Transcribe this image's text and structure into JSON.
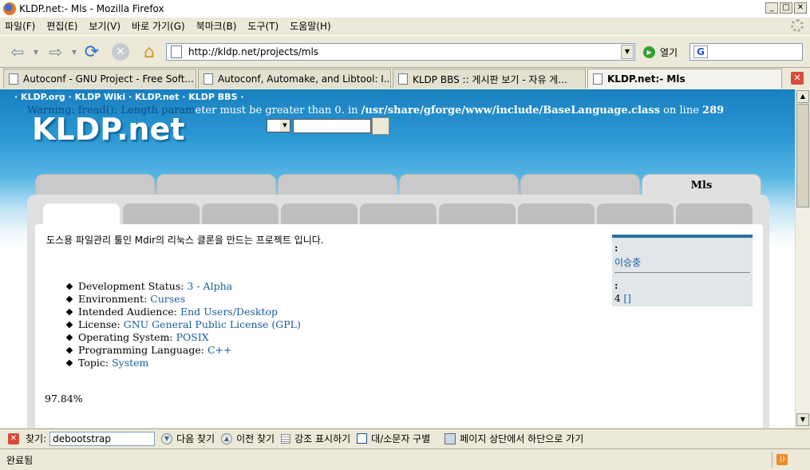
{
  "window": {
    "title": "KLDP.net:- Mls - Mozilla Firefox",
    "controls": {
      "minimize": "_",
      "maximize": "□",
      "close": "✕"
    }
  },
  "menu": [
    "파일(F)",
    "편집(E)",
    "보기(V)",
    "바로 가기(G)",
    "북마크(B)",
    "도구(T)",
    "도움말(H)"
  ],
  "toolbar": {
    "url": "http://kldp.net/projects/mls",
    "go_label": "열기",
    "search_value": "",
    "search_engine": "G"
  },
  "tabs": [
    {
      "label": "Autoconf - GNU Project - Free Soft...",
      "active": false
    },
    {
      "label": "Autoconf, Automake, and Libtool: I...",
      "active": false
    },
    {
      "label": "KLDP BBS :: 게시판 보기 - 자유 게...",
      "active": false
    },
    {
      "label": "KLDP.net:- Mls",
      "active": true
    }
  ],
  "page": {
    "top_links": "· KLDP.org · KLDP Wiki · KLDP.net · KLDP BBS ·",
    "warning_prefix": "Warning: fread(): Length param",
    "warning_text": "eter must be greater than 0. in ",
    "warning_path": "/usr/share/gforge/www/include/BaseLanguage.class",
    "warning_suffix": " on line ",
    "warning_line": "289",
    "logo": "KLDP.net",
    "project_tab": "Mls",
    "description": "도스용 파일관리 툴인 Mdir의 리눅스 클론을 만드는 프로젝트 입니다.",
    "trove": [
      {
        "label": "Development Status: ",
        "value": "3 - Alpha"
      },
      {
        "label": "Environment: ",
        "value": "Curses"
      },
      {
        "label": "Intended Audience: ",
        "value": "End Users/Desktop"
      },
      {
        "label": "License: ",
        "value": "GNU General Public License (GPL)"
      },
      {
        "label": "Operating System: ",
        "value": "POSIX"
      },
      {
        "label": "Programming Language: ",
        "value": "C++"
      },
      {
        "label": "Topic: ",
        "value": "System"
      }
    ],
    "activity_percent": "97.84%",
    "sidebox": {
      "label1": ":",
      "admin": "이승충",
      "label2": ":",
      "dev_count": "4",
      "dev_link": "[]"
    }
  },
  "findbar": {
    "label": "찾기:",
    "value": "debootstrap",
    "next": "다음 찾기",
    "prev": "이전 찾기",
    "highlight": "강조 표시하기",
    "match_case": "대/소문자 구별",
    "wrap_message": "페이지 상단에서 하단으로 가기"
  },
  "status": {
    "text": "완료됨"
  }
}
